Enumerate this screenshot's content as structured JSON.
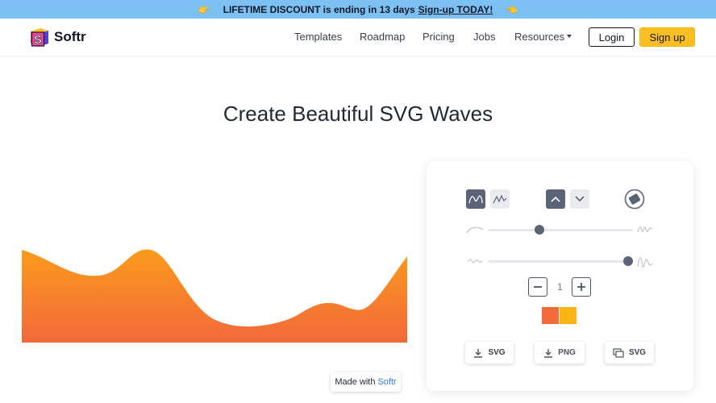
{
  "banner": {
    "left_icon": "pointing-hand-icon",
    "text": "LIFETIME DISCOUNT is ending in 13 days",
    "link": "Sign-up TODAY!",
    "right_icon": "pointing-hand-icon"
  },
  "nav": {
    "brand": "Softr",
    "links": [
      "Templates",
      "Roadmap",
      "Pricing",
      "Jobs",
      "Resources"
    ],
    "login": "Login",
    "signup": "Sign up"
  },
  "page": {
    "title": "Create Beautiful SVG Waves"
  },
  "made_with": {
    "prefix": "Made with",
    "link": "Softr"
  },
  "panel": {
    "curve_styles": [
      "smooth-wave-icon",
      "peak-wave-icon"
    ],
    "selected_curve": "smooth-wave-icon",
    "directions": [
      "chevron-up-icon",
      "chevron-down-icon"
    ],
    "selected_direction": "chevron-up-icon",
    "randomize_icon": "dice-icon",
    "complexity_level": 0.33,
    "amplitude_level": 1.0,
    "layers": "1",
    "colors": [
      "#f26b3a",
      "#fbb316"
    ],
    "export": {
      "svg": "SVG",
      "png": "PNG",
      "copy_svg": "SVG"
    }
  },
  "colors": {
    "banner": "#7cc0f4",
    "accent": "#fbbf24",
    "wave_top": "#fb9b1c",
    "wave_bottom": "#f2693b",
    "control": "#5b6376"
  }
}
